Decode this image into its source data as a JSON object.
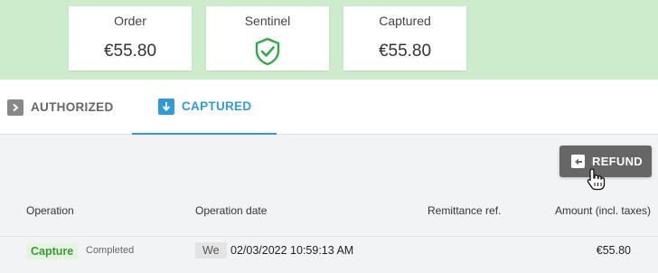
{
  "summary_cards": [
    {
      "title": "Order",
      "value": "€55.80"
    },
    {
      "title": "Sentinel",
      "icon": "shield-check-icon",
      "icon_color": "#2fa84f"
    },
    {
      "title": "Captured",
      "value": "€55.80"
    }
  ],
  "tabs": [
    {
      "label": "AUTHORIZED",
      "icon": "chevron-right-icon",
      "active": false
    },
    {
      "label": "CAPTURED",
      "icon": "arrow-down-icon",
      "active": true
    }
  ],
  "actions": {
    "refund_label": "REFUND"
  },
  "table": {
    "headers": [
      "Operation",
      "Operation date",
      "Remittance ref.",
      "Amount (incl. taxes)"
    ],
    "rows": [
      {
        "operation": "Capture",
        "status": "Completed",
        "day": "We",
        "date": "02/03/2022 10:59:13 AM",
        "remittance_ref": "",
        "amount": "€55.80"
      }
    ]
  },
  "colors": {
    "accent": "#2d9cdb",
    "success": "#2fa84f",
    "top_band": "#cdeccb"
  }
}
